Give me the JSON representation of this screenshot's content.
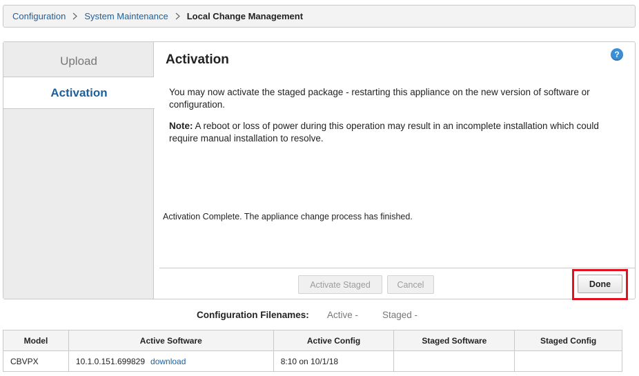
{
  "breadcrumb": {
    "items": [
      "Configuration",
      "System Maintenance"
    ],
    "current": "Local Change Management"
  },
  "sidebar": {
    "tabs": [
      {
        "label": "Upload",
        "active": false
      },
      {
        "label": "Activation",
        "active": true
      }
    ]
  },
  "main": {
    "title": "Activation",
    "help_icon": "?",
    "paragraph1": "You may now activate the staged package - restarting this appliance on the new version of software or configuration.",
    "note_label": "Note:",
    "note_text": " A reboot or loss of power during this operation may result in an incomplete installation which could require manual installation to resolve.",
    "status_message": "Activation Complete. The appliance change process has finished."
  },
  "footer": {
    "activate_staged_label": "Activate Staged",
    "cancel_label": "Cancel",
    "done_label": "Done"
  },
  "config_filenames": {
    "label": "Configuration Filenames:",
    "active": "Active -",
    "staged": "Staged -"
  },
  "table": {
    "columns": [
      "Model",
      "Active Software",
      "Active Config",
      "Staged Software",
      "Staged Config"
    ],
    "rows": [
      {
        "model": "CBVPX",
        "active_software": "10.1.0.151.699829",
        "download_label": "download",
        "active_config": "8:10 on 10/1/18",
        "staged_software": "",
        "staged_config": ""
      }
    ]
  },
  "colors": {
    "accent": "#1b5f9e",
    "highlight": "#e0121f",
    "help": "#3b8fd6"
  }
}
